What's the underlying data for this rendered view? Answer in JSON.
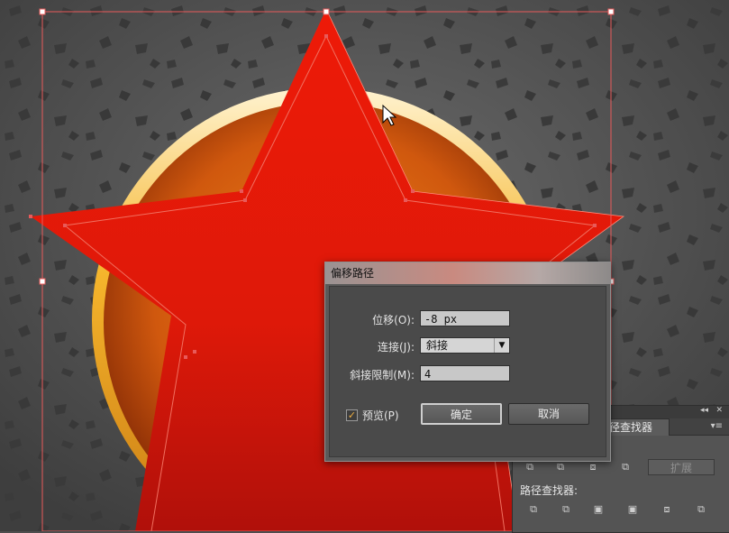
{
  "dialog": {
    "title": "偏移路径",
    "offset_label": "位移(O):",
    "offset_value": "-8 px",
    "joins_label": "连接(J):",
    "joins_value": "斜接",
    "miter_label": "斜接限制(M):",
    "miter_value": "4",
    "preview_label": "预览(P)",
    "preview_checked": true,
    "ok_label": "确定",
    "cancel_label": "取消"
  },
  "pathfinder": {
    "tab_label": "径查找器",
    "expand_label": "扩展",
    "pathfinders_label": "路径查找器:",
    "menu_icon": "panel-menu-icon"
  },
  "colors": {
    "star_red": "#e41b0a",
    "ring_gold": "#f5b52c",
    "background": "#4e4e4e",
    "selection": "#e85a5a"
  }
}
